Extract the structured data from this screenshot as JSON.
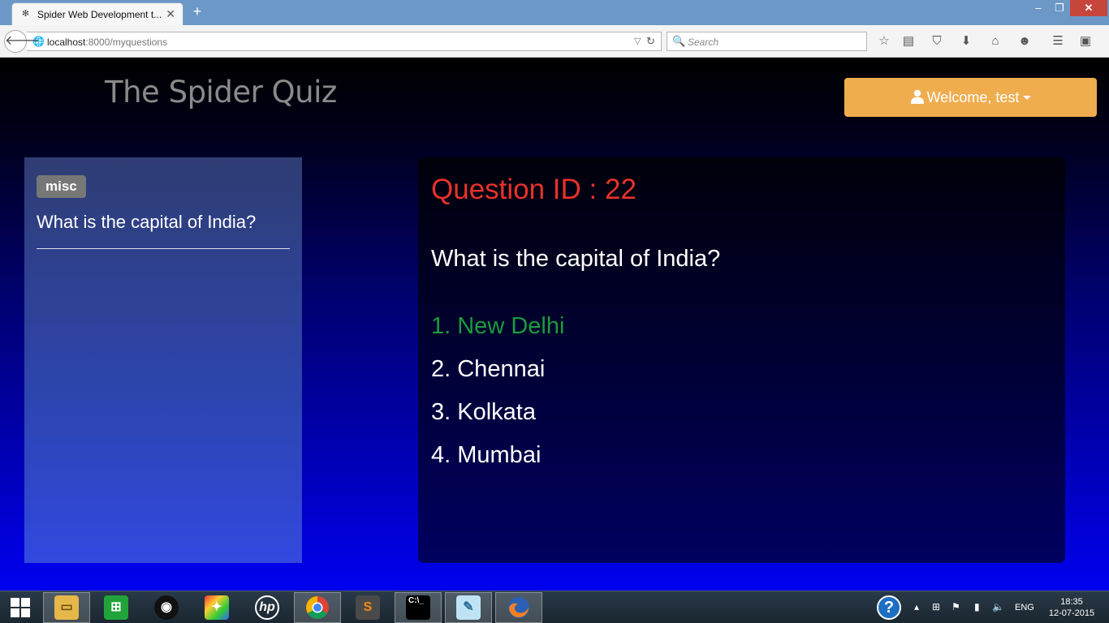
{
  "browser": {
    "tab_title": "Spider Web Development t...",
    "tab_favicon": "spider-icon",
    "new_tab_label": "+",
    "url_host": "localhost",
    "url_path": ":8000/myquestions",
    "search_placeholder": "Search"
  },
  "site": {
    "title": "The Spider Quiz",
    "welcome_label": "Welcome, test",
    "welcome_color": "#f0ad4e"
  },
  "sidebar": {
    "tag": "misc",
    "items": [
      {
        "text": "What is the capital of India?"
      }
    ]
  },
  "question": {
    "id_label": "Question ID : 22",
    "text": "What is the capital of India?",
    "options": [
      {
        "label": "1. New Delhi",
        "correct": true
      },
      {
        "label": "2. Chennai",
        "correct": false
      },
      {
        "label": "3. Kolkata",
        "correct": false
      },
      {
        "label": "4. Mumbai",
        "correct": false
      }
    ],
    "id_color": "#e8322c",
    "correct_color": "#1a9c3c"
  },
  "taskbar": {
    "language": "ENG",
    "time": "18:35",
    "date": "12-07-2015",
    "apps": [
      "file-explorer-icon",
      "store-icon",
      "webcam-icon",
      "puzzle-app-icon",
      "hp-icon",
      "chrome-icon",
      "sublime-text-icon",
      "command-prompt-icon",
      "notepad-icon",
      "firefox-icon"
    ]
  }
}
